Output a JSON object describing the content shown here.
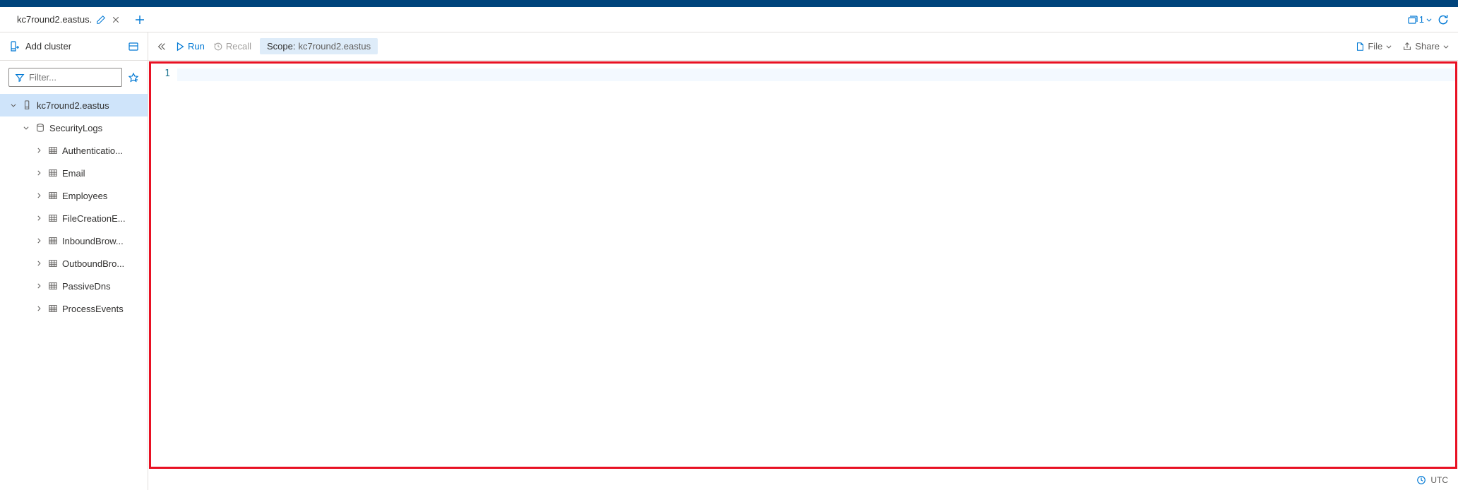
{
  "tab": {
    "title": "kc7round2.eastus."
  },
  "tabs_badge": "1",
  "sidebar": {
    "add_cluster_label": "Add cluster",
    "filter_placeholder": "Filter...",
    "tree": {
      "cluster": {
        "label": "kc7round2.eastus"
      },
      "database": {
        "label": "SecurityLogs"
      },
      "tables": [
        {
          "label": "Authenticatio..."
        },
        {
          "label": "Email"
        },
        {
          "label": "Employees"
        },
        {
          "label": "FileCreationE..."
        },
        {
          "label": "InboundBrow..."
        },
        {
          "label": "OutboundBro..."
        },
        {
          "label": "PassiveDns"
        },
        {
          "label": "ProcessEvents"
        }
      ]
    }
  },
  "toolbar": {
    "run_label": "Run",
    "recall_label": "Recall",
    "scope_label": "Scope:",
    "scope_value": "kc7round2.eastus",
    "file_label": "File",
    "share_label": "Share"
  },
  "editor": {
    "line_number": "1",
    "line_content": ""
  },
  "statusbar": {
    "timezone": "UTC"
  }
}
